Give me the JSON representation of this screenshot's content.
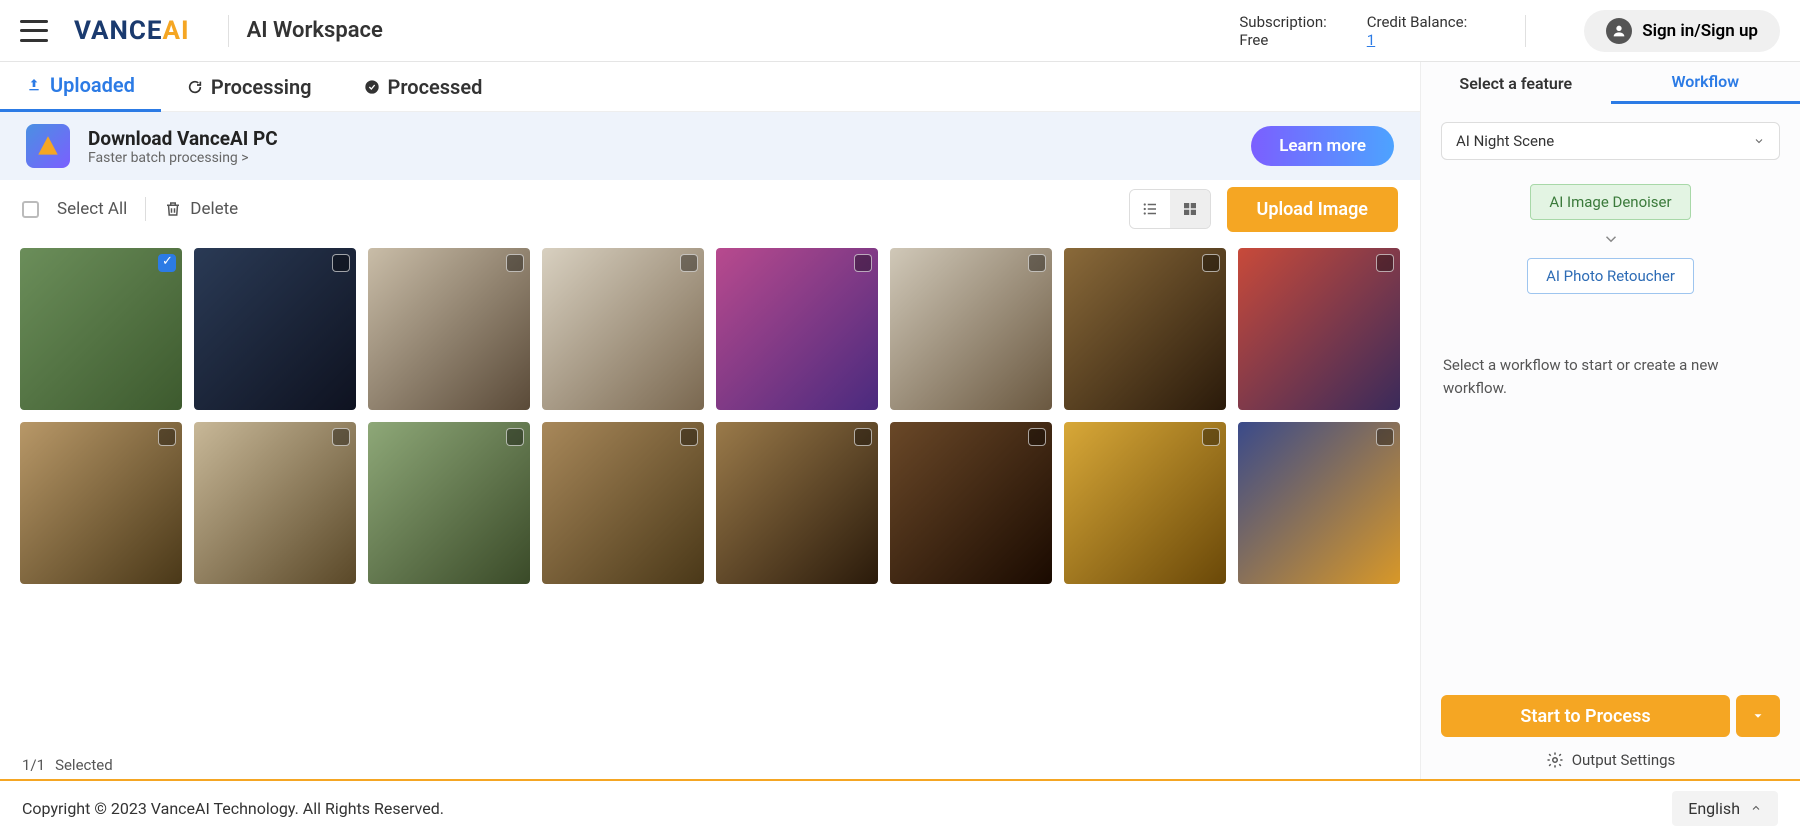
{
  "header": {
    "logo_main": "VANCE",
    "logo_suffix": "AI",
    "workspace_title": "AI Workspace",
    "subscription_label": "Subscription:",
    "subscription_value": "Free",
    "credit_label": "Credit Balance:",
    "credit_value": "1",
    "signin_label": "Sign in/Sign up"
  },
  "tabs": {
    "uploaded": "Uploaded",
    "processing": "Processing",
    "processed": "Processed"
  },
  "promo": {
    "title": "Download VanceAI PC",
    "subtitle": "Faster batch processing >",
    "cta": "Learn more"
  },
  "toolbar": {
    "select_all": "Select All",
    "delete": "Delete",
    "upload": "Upload Image"
  },
  "thumbnails": [
    {
      "class": "ph0",
      "selected": true
    },
    {
      "class": "ph1",
      "selected": false
    },
    {
      "class": "ph2",
      "selected": false
    },
    {
      "class": "ph3",
      "selected": false
    },
    {
      "class": "ph4",
      "selected": false
    },
    {
      "class": "ph5",
      "selected": false
    },
    {
      "class": "ph6",
      "selected": false
    },
    {
      "class": "ph7",
      "selected": false
    },
    {
      "class": "ph8",
      "selected": false
    },
    {
      "class": "ph9",
      "selected": false
    },
    {
      "class": "ph10",
      "selected": false
    },
    {
      "class": "ph11",
      "selected": false
    },
    {
      "class": "ph12",
      "selected": false
    },
    {
      "class": "ph13",
      "selected": false
    },
    {
      "class": "ph14",
      "selected": false
    },
    {
      "class": "ph15",
      "selected": false
    }
  ],
  "status": {
    "page": "1/1",
    "selected": "Selected"
  },
  "right": {
    "tab_feature": "Select a feature",
    "tab_workflow": "Workflow",
    "select_value": "AI Night Scene",
    "step1": "AI Image Denoiser",
    "step2": "AI Photo Retoucher",
    "hint": "Select a workflow to start or create a new workflow.",
    "process": "Start to Process",
    "output": "Output Settings"
  },
  "footer": {
    "copyright": "Copyright © 2023 VanceAI Technology. All Rights Reserved.",
    "language": "English"
  }
}
